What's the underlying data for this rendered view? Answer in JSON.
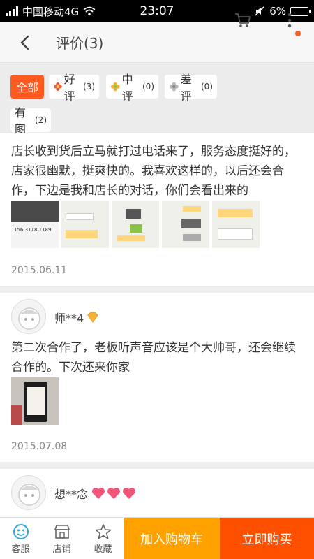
{
  "status_bar": {
    "carrier": "中国移动4G",
    "time": "23:07",
    "battery_text": "6%",
    "battery_level": 0.06
  },
  "nav": {
    "title": "评价(3)",
    "back_icon": "chevron-left-icon",
    "cart_icon": "cart-icon",
    "more_icon": "more-vertical-icon"
  },
  "filters": [
    {
      "label": "全部",
      "count": "",
      "active": true
    },
    {
      "label": "好评",
      "count": "(3)",
      "icon": "flower-red-icon"
    },
    {
      "label": "中评",
      "count": "(0)",
      "icon": "flower-yellow-icon"
    },
    {
      "label": "差评",
      "count": "(0)",
      "icon": "flower-gray-icon"
    },
    {
      "label": "有图",
      "count": "(2)"
    }
  ],
  "reviews": [
    {
      "text_lines": [
        "店长收到货后立马就打过电话来了，服务态度挺好的，",
        "店家很幽默，挺爽快的。我喜欢这样的，以后还会合",
        "作，下边是我和店长的对话，你们会看出来的"
      ],
      "thumb_text": "156 3118 1189",
      "date": "2015.06.11"
    },
    {
      "user": "师**4",
      "text_lines": [
        "第二次合作了，老板听声音应该是个大帅哥，还会继续",
        "合作的。下次还来你家"
      ],
      "date": "2015.07.08"
    },
    {
      "user": "想**念"
    }
  ],
  "bottom_bar": {
    "service": "客服",
    "shop": "店铺",
    "favorite": "收藏",
    "add_to_cart": "加入购物车",
    "buy_now": "立即购买"
  },
  "colors": {
    "accent": "#ff5a1f",
    "cart_button": "#ffa200",
    "buy_button": "#ff5000",
    "service_icon": "#2fa8e0"
  }
}
